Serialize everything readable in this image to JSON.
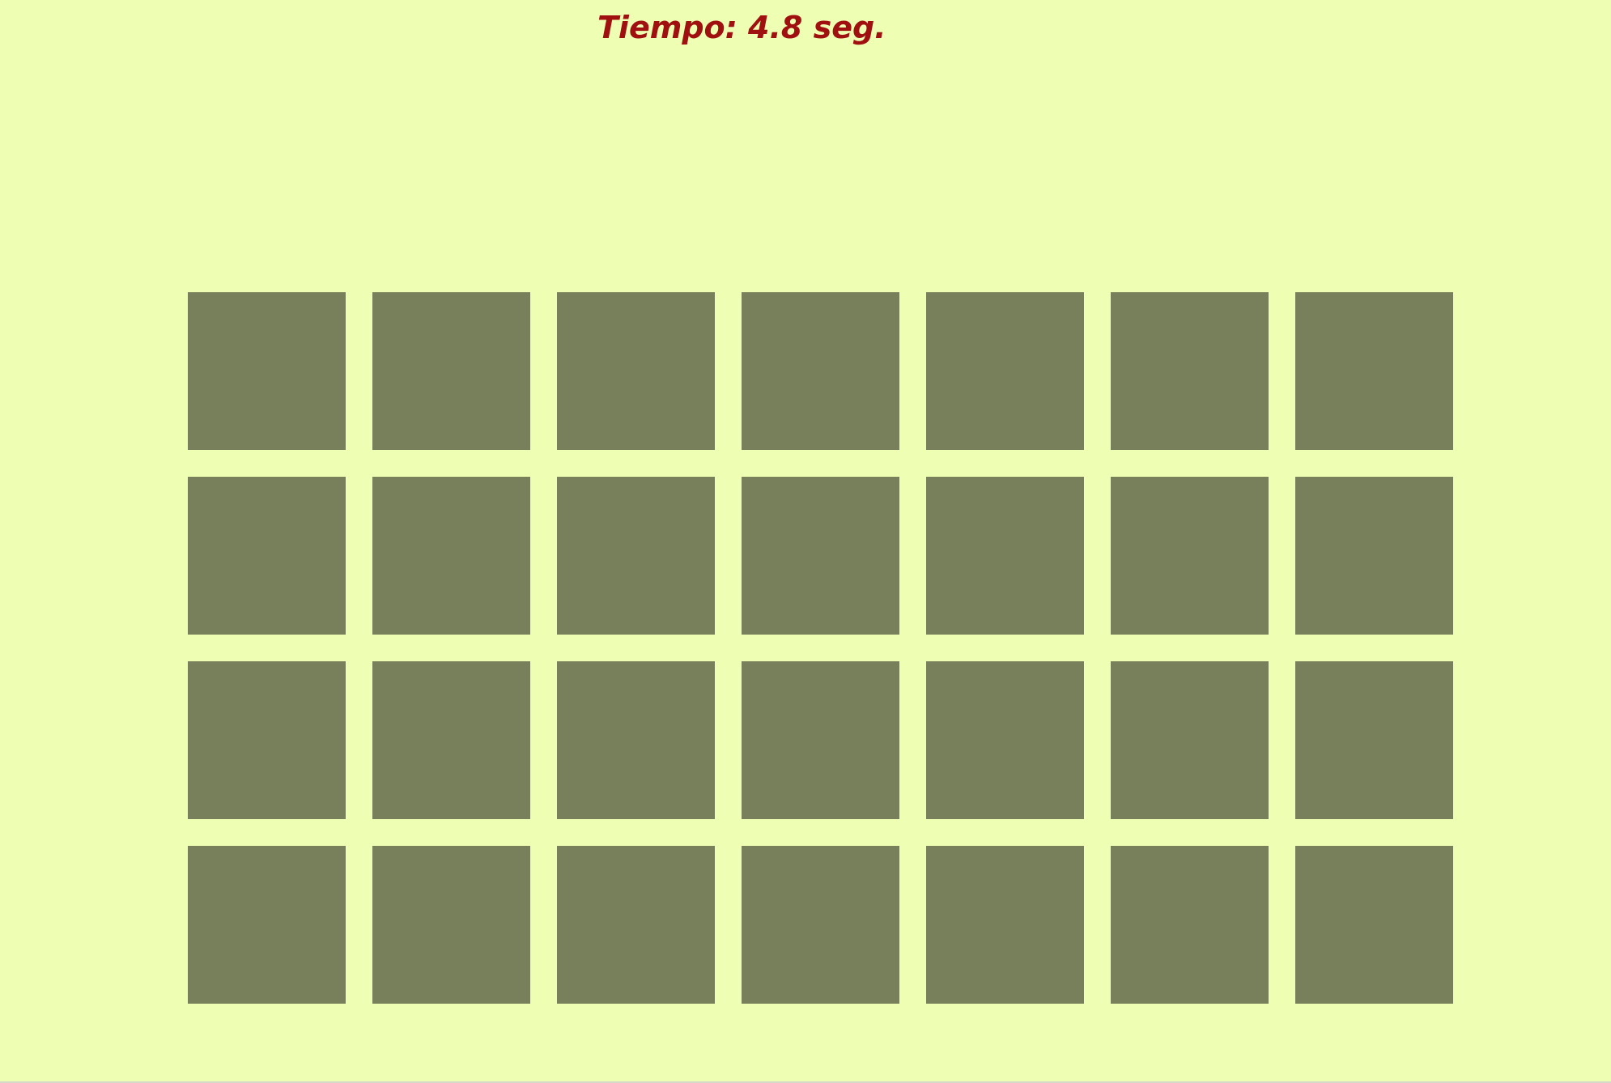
{
  "timer": {
    "text": "Tiempo: 4.8 seg."
  },
  "board": {
    "rows": 4,
    "columns": 7,
    "cards": [
      {
        "state": "face-down"
      },
      {
        "state": "face-down"
      },
      {
        "state": "face-down"
      },
      {
        "state": "face-down"
      },
      {
        "state": "face-down"
      },
      {
        "state": "face-down"
      },
      {
        "state": "face-down"
      },
      {
        "state": "face-down"
      },
      {
        "state": "face-down"
      },
      {
        "state": "face-down"
      },
      {
        "state": "face-down"
      },
      {
        "state": "face-down"
      },
      {
        "state": "face-down"
      },
      {
        "state": "face-down"
      },
      {
        "state": "face-down"
      },
      {
        "state": "face-down"
      },
      {
        "state": "face-down"
      },
      {
        "state": "face-down"
      },
      {
        "state": "face-down"
      },
      {
        "state": "face-down"
      },
      {
        "state": "face-down"
      },
      {
        "state": "face-down"
      },
      {
        "state": "face-down"
      },
      {
        "state": "face-down"
      },
      {
        "state": "face-down"
      },
      {
        "state": "face-down"
      },
      {
        "state": "face-down"
      },
      {
        "state": "face-down"
      }
    ]
  },
  "colors": {
    "background": "#eeffb4",
    "card_back": "#77805b",
    "timer_text": "#a01010"
  }
}
